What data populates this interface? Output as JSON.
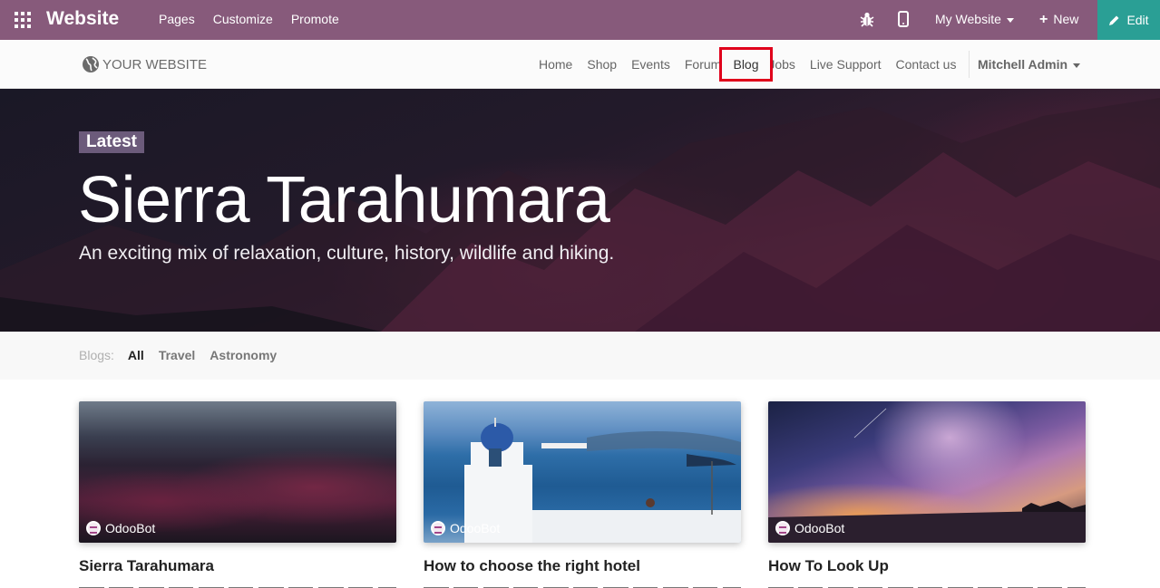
{
  "topbar": {
    "brand": "Website",
    "menu": [
      "Pages",
      "Customize",
      "Promote"
    ],
    "site_selector": "My Website",
    "new_label": "New",
    "edit_label": "Edit",
    "icons": [
      "apps-icon",
      "bug-icon",
      "mobile-icon",
      "plus-icon",
      "pencil-icon"
    ],
    "colors": {
      "bar": "#875a7b",
      "edit": "#2a9f95"
    }
  },
  "sitenav": {
    "logo_text": "YOUR WEBSITE",
    "links": [
      "Home",
      "Shop",
      "Events",
      "Forum",
      "Blog",
      "Jobs",
      "Live Support",
      "Contact us"
    ],
    "highlighted_link": "Blog",
    "highlight_color": "#e0001b",
    "user": "Mitchell Admin"
  },
  "hero": {
    "badge": "Latest",
    "title": "Sierra Tarahumara",
    "subtitle": "An exciting mix of relaxation, culture, history, wildlife and hiking."
  },
  "filters": {
    "label": "Blogs:",
    "items": [
      "All",
      "Travel",
      "Astronomy"
    ],
    "active": "All"
  },
  "posts": [
    {
      "title": "Sierra Tarahumara",
      "author": "OdooBot"
    },
    {
      "title": "How to choose the right hotel",
      "author": "OdooBot"
    },
    {
      "title": "How To Look Up",
      "author": "OdooBot"
    }
  ]
}
